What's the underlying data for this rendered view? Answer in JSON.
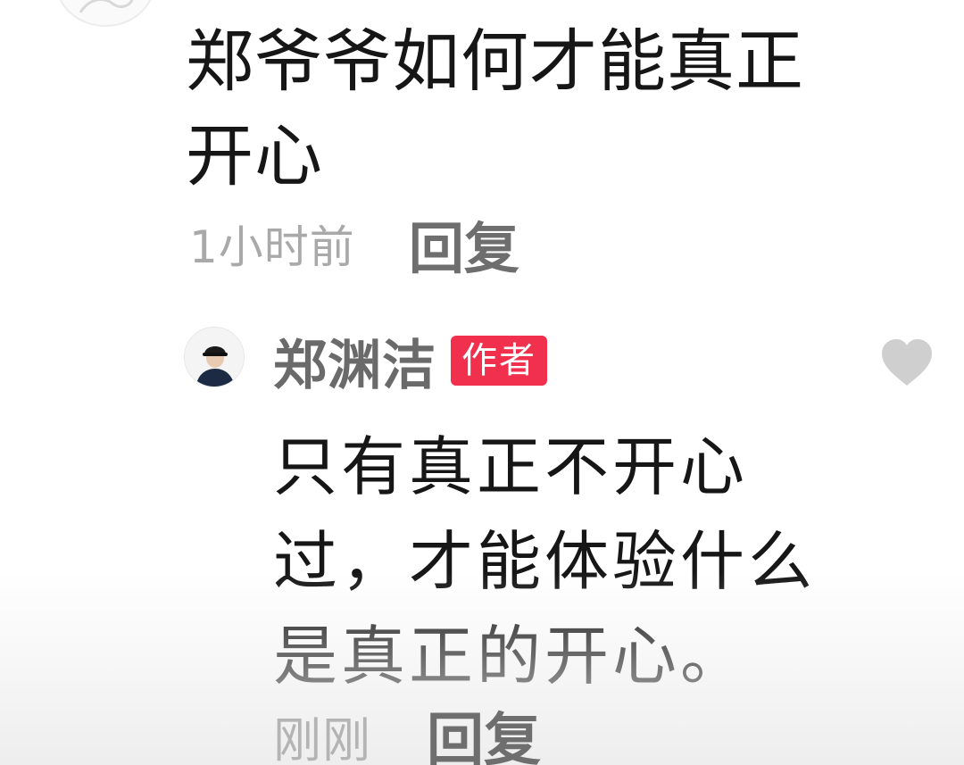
{
  "comment": {
    "text": "郑爷爷如何才能真正开心",
    "time": "1小时前",
    "reply_label": "回复"
  },
  "reply": {
    "author_name": "郑渊洁",
    "author_badge": "作者",
    "text": "只有真正不开心过，才能体验什么是真正的开心。",
    "time": "刚刚",
    "reply_label": "回复",
    "like_icon": "heart-icon"
  },
  "colors": {
    "badge_bg": "#f0304d",
    "like_icon": "#cfcfcf",
    "meta_text": "#a9a9a9"
  }
}
